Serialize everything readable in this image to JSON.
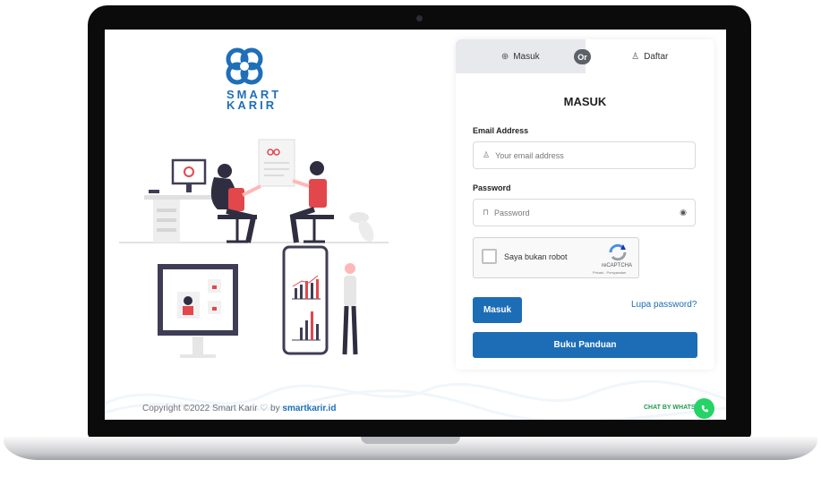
{
  "brand": {
    "line1": "SMART",
    "line2": "KARIR",
    "color": "#1e6fb8"
  },
  "tabs": [
    {
      "label": "Masuk",
      "icon": "login-icon",
      "active": true
    },
    {
      "label": "Daftar",
      "icon": "user-icon",
      "active": false
    }
  ],
  "or_label": "Or",
  "form": {
    "heading": "MASUK",
    "email_label": "Email Address",
    "email_placeholder": "Your email address",
    "password_label": "Password",
    "password_placeholder": "Password"
  },
  "captcha": {
    "label": "Saya bukan robot",
    "brand": "reCAPTCHA",
    "links": "Privasi - Persyaratan"
  },
  "buttons": {
    "login": "Masuk",
    "forgot": "Lupa password?",
    "guide": "Buku Panduan"
  },
  "footer": {
    "copyright": "Copyright ©2022 Smart Karir ♡ by",
    "link": "smartkarir.id",
    "chat": "CHAT BY WHATSAPP"
  },
  "colors": {
    "primary": "#1c6db6",
    "accent": "#e2474b",
    "whatsapp": "#25d366"
  }
}
